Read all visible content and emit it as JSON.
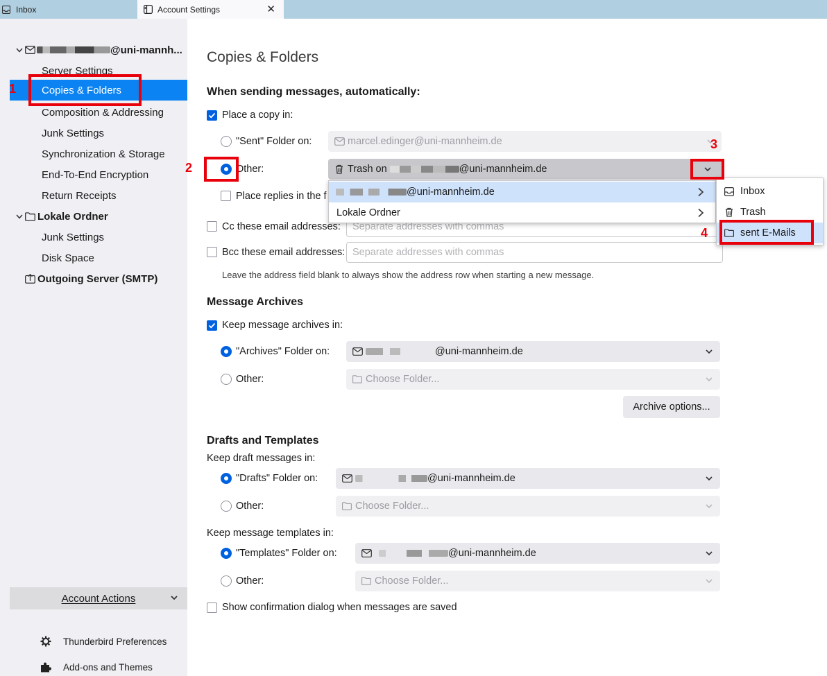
{
  "tabs": [
    {
      "label": "Inbox",
      "icon": "inbox-icon"
    },
    {
      "label": "Account Settings",
      "icon": "settings-page-icon",
      "close": "✕"
    }
  ],
  "sidebar": {
    "account": {
      "suffix": "@uni-mannheim.de",
      "display": "@uni-mannh..."
    },
    "account_items": [
      "Server Settings",
      "Copies & Folders",
      "Composition & Addressing",
      "Junk Settings",
      "Synchronization & Storage",
      "End-To-End Encryption",
      "Return Receipts"
    ],
    "selected": "Copies & Folders",
    "local_folders": {
      "label": "Lokale Ordner",
      "items": [
        "Junk Settings",
        "Disk Space"
      ]
    },
    "smtp": "Outgoing Server (SMTP)",
    "account_actions": "Account Actions",
    "footer": [
      "Thunderbird Preferences",
      "Add-ons and Themes"
    ]
  },
  "page": {
    "title": "Copies & Folders",
    "sending": {
      "heading": "When sending messages, automatically:",
      "place_copy": {
        "label": "Place a copy in:",
        "checked": true
      },
      "sent_folder": {
        "label": "\"Sent\" Folder on:",
        "value": "marcel.edinger@uni-mannheim.de",
        "selected": false
      },
      "other": {
        "label": "Other:",
        "value": "Trash on",
        "value_suffix": "@uni-mannheim.de",
        "selected": true
      },
      "place_replies": {
        "label": "Place replies in the f",
        "checked": false
      },
      "cc": {
        "label": "Cc these email addresses:",
        "placeholder": "Separate addresses with commas",
        "checked": false
      },
      "bcc": {
        "label": "Bcc these email addresses:",
        "placeholder": "Separate addresses with commas",
        "checked": false
      },
      "hint": "Leave the address field blank to always show the address row when starting a new message."
    },
    "archives": {
      "heading": "Message Archives",
      "keep": {
        "label": "Keep message archives in:",
        "checked": true
      },
      "folder_on": {
        "label": "\"Archives\" Folder on:",
        "value": "@uni-mannheim.de",
        "selected": true
      },
      "other": {
        "label": "Other:",
        "value": "Choose Folder...",
        "selected": false
      },
      "options_button": "Archive options..."
    },
    "drafts": {
      "heading": "Drafts and Templates",
      "drafts_label": "Keep draft messages in:",
      "drafts_folder": {
        "label": "\"Drafts\" Folder on:",
        "value": "@uni-mannheim.de",
        "selected": true
      },
      "drafts_other": {
        "label": "Other:",
        "value": "Choose Folder...",
        "selected": false
      },
      "templates_label": "Keep message templates in:",
      "templates_folder": {
        "label": "\"Templates\" Folder on:",
        "value": "@uni-mannheim.de",
        "selected": true
      },
      "templates_other": {
        "label": "Other:",
        "value": "Choose Folder...",
        "selected": false
      },
      "confirm": {
        "label": "Show confirmation dialog when messages are saved",
        "checked": false
      }
    }
  },
  "popup_accounts": [
    {
      "label": "@uni-mannheim.de",
      "highlighted": true
    },
    {
      "label": "Lokale Ordner",
      "highlighted": false
    }
  ],
  "popup_folders": [
    {
      "label": "Inbox",
      "icon": "inbox-icon"
    },
    {
      "label": "Trash",
      "icon": "trash-icon"
    },
    {
      "label": "sent E-Mails",
      "icon": "folder-icon",
      "highlighted": true
    }
  ],
  "annotations": [
    "1",
    "2",
    "3",
    "4"
  ],
  "colors": {
    "accent": "#0061e0",
    "selection": "#0b83f2",
    "annotation": "#e8000b",
    "sidebar_bg": "#f0f0f4",
    "tabbar_bg": "#b0cfe0"
  }
}
